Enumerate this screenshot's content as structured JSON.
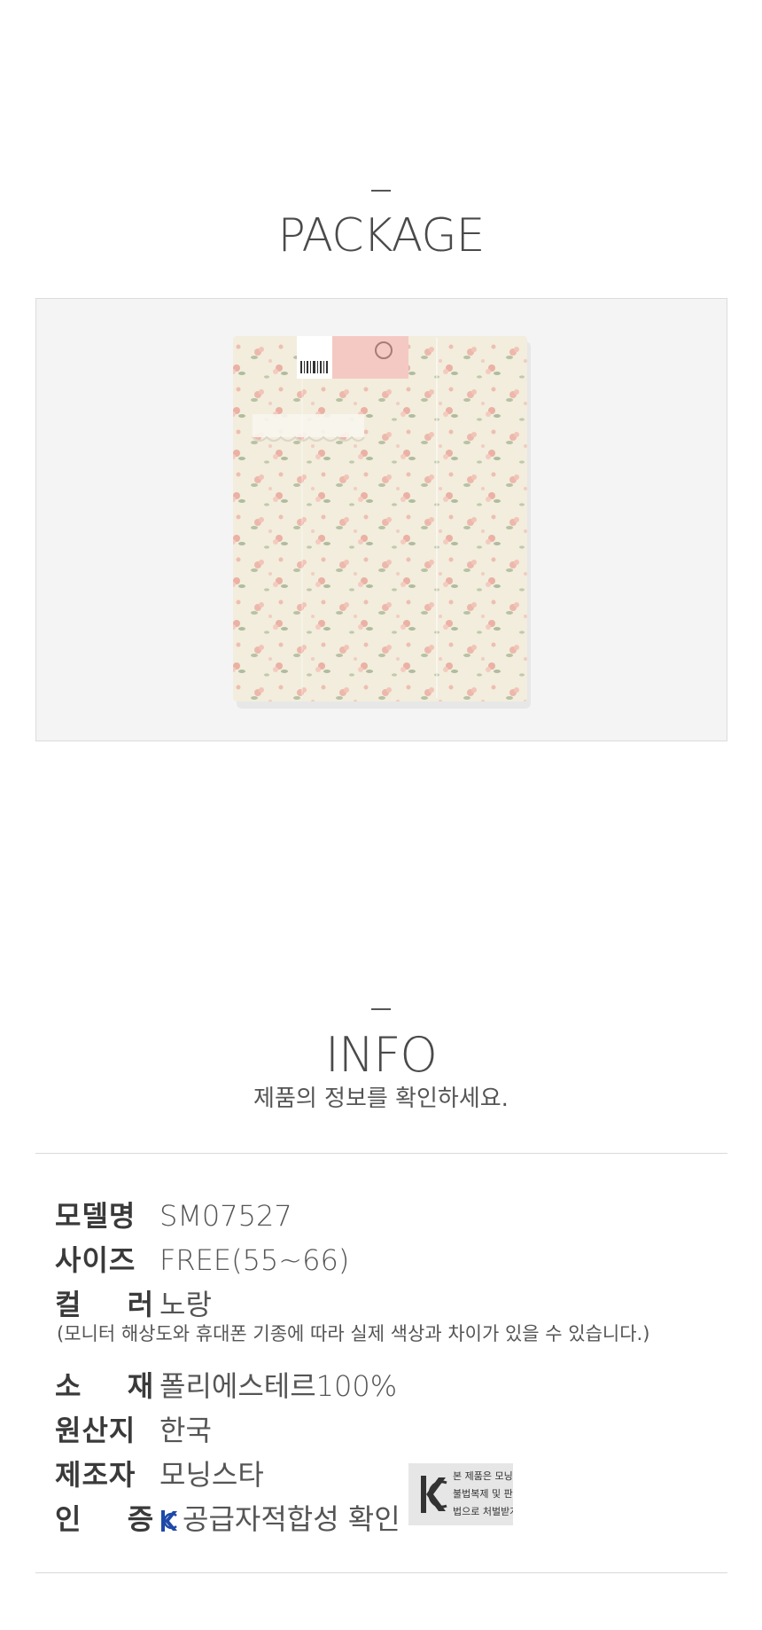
{
  "package": {
    "title": "PACKAGE"
  },
  "info": {
    "title": "INFO",
    "subtitle": "제품의 정보를 확인하세요.",
    "rows": [
      {
        "label": "모델명",
        "value": "SM07527"
      },
      {
        "label": "사이즈",
        "value": "FREE(55~66)"
      },
      {
        "label": "컬  러",
        "value": "노랑"
      },
      {
        "label": "소  재",
        "value": "폴리에스테르100%"
      },
      {
        "label": "원산지",
        "value": "한국"
      },
      {
        "label": "제조자",
        "value": "모닝스타"
      },
      {
        "label": "인  증",
        "value": "공급자적합성 확인"
      }
    ],
    "color_note": "(모니터 해상도와 휴대폰 기종에 따라 실제 색상과 차이가 있을 수 있습니다.)",
    "kc_notice": [
      "본 제품은 모닝",
      "불법복제 및 판매",
      "법으로 처벌받게"
    ]
  },
  "colors": {
    "background": "#ffffff",
    "text": "#444444",
    "rule": "#d9d9d9",
    "kc_blue": "#1e4aa8"
  }
}
